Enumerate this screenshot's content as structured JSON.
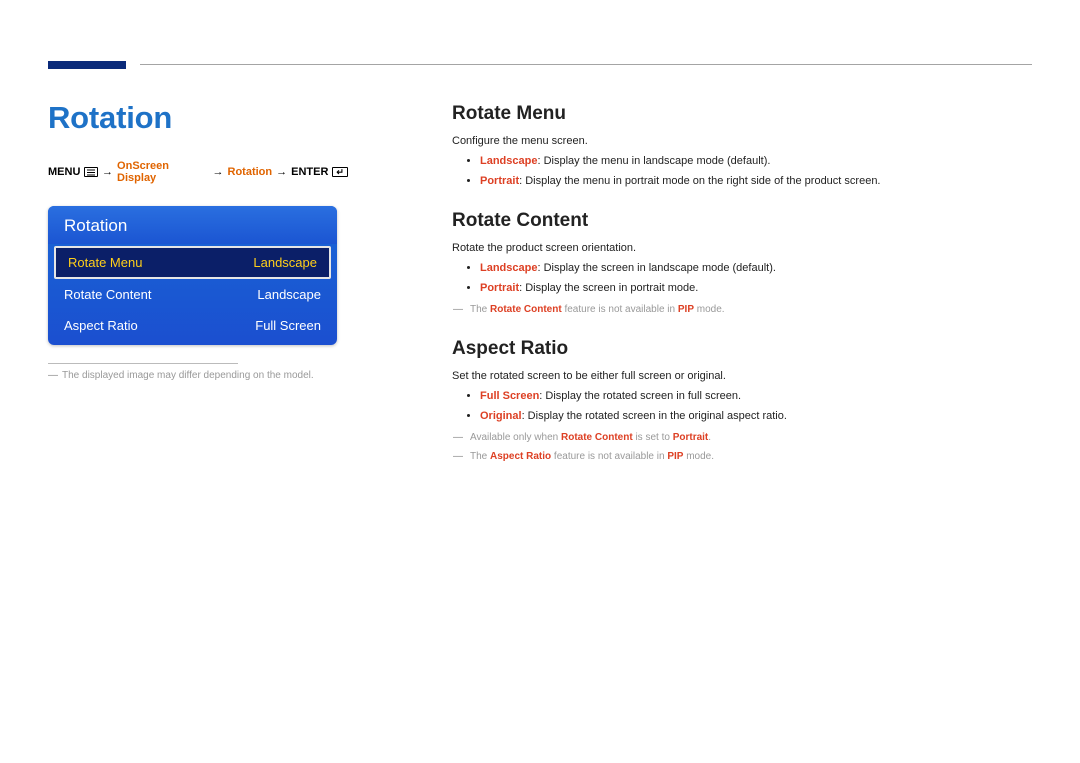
{
  "top": {},
  "left": {
    "title": "Rotation",
    "breadcrumb": {
      "menu": "MENU",
      "seg1": "OnScreen Display",
      "seg2": "Rotation",
      "enter": "ENTER"
    },
    "osd": {
      "title": "Rotation",
      "rows": [
        {
          "label": "Rotate Menu",
          "value": "Landscape"
        },
        {
          "label": "Rotate Content",
          "value": "Landscape"
        },
        {
          "label": "Aspect Ratio",
          "value": "Full Screen"
        }
      ]
    },
    "footnote": "The displayed image may differ depending on the model."
  },
  "right": {
    "s1": {
      "h": "Rotate Menu",
      "p": "Configure the menu screen.",
      "opts": [
        {
          "k": "Landscape",
          "v": ": Display the menu in landscape mode (default)."
        },
        {
          "k": "Portrait",
          "v": ": Display the menu in portrait mode on the right side of the product screen."
        }
      ]
    },
    "s2": {
      "h": "Rotate Content",
      "p": "Rotate the product screen orientation.",
      "opts": [
        {
          "k": "Landscape",
          "v": ": Display the screen in landscape mode (default)."
        },
        {
          "k": "Portrait",
          "v": ": Display the screen in portrait mode."
        }
      ],
      "note_pre": "The ",
      "note_k": "Rotate Content",
      "note_mid": " feature is not available in ",
      "note_pip": "PIP",
      "note_post": " mode."
    },
    "s3": {
      "h": "Aspect Ratio",
      "p": "Set the rotated screen to be either full screen or original.",
      "opts": [
        {
          "k": "Full Screen",
          "v": ": Display the rotated screen in full screen."
        },
        {
          "k": "Original",
          "v": ": Display the rotated screen in the original aspect ratio."
        }
      ],
      "note1_pre": "Available only when ",
      "note1_a": "Rotate Content",
      "note1_mid": " is set to ",
      "note1_b": "Portrait",
      "note1_post": ".",
      "note2_pre": "The ",
      "note2_k": "Aspect Ratio",
      "note2_mid": " feature is not available in ",
      "note2_pip": "PIP",
      "note2_post": " mode."
    }
  }
}
